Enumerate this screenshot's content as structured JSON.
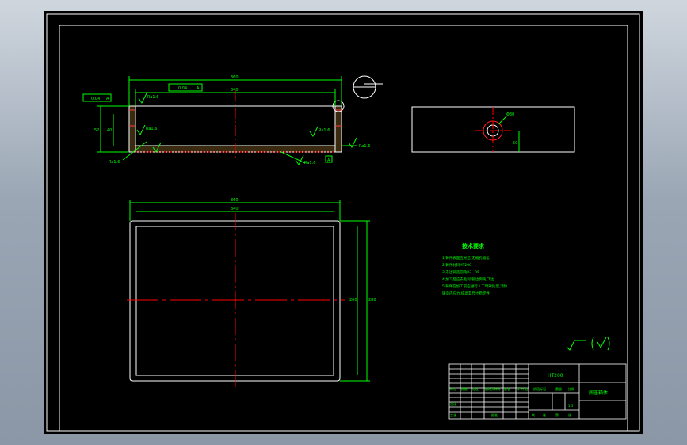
{
  "drawing": {
    "material": "HT200",
    "part_name": "底座箱体",
    "tech_title": "技术要求",
    "tech_notes": [
      "1.铸件表面应光洁,无缩孔缩松",
      "2.铸件材料HT200",
      "3.未注铸造圆角R3~R5",
      "4.加工后应去毛刺,锐边倒钝,飞边.",
      "5.铸件在加工前应进行人工时效处理,消除",
      "铸造内应力,提高其尺寸稳定性."
    ],
    "title_block": {
      "labels": [
        "标记",
        "处数",
        "分区",
        "更改文件号",
        "签名",
        "年.月.日"
      ],
      "stage_label": "阶段标记",
      "weight_label": "重量",
      "scale_label": "比例",
      "scale_value": "1:5",
      "sheet_labels": [
        "共",
        "张",
        "第",
        "张"
      ],
      "designer_label": "设计",
      "process_label": "工艺",
      "approve_label": "批准"
    },
    "dimensions": {
      "top_overall": "360",
      "top_inner": "340",
      "tol1_a": "0.04",
      "tol1_b": "A",
      "tol2_a": "0.04",
      "tol2_b": "A",
      "height": "52",
      "height2": "40",
      "rough_a": "Ra1.6",
      "rough_b": "Ra1.6",
      "rough_c": "Ra1.6",
      "rough_d": "Ra1.6",
      "rough_e": "Ra1.6",
      "rough_f": "Ra1.6",
      "datum": "A",
      "hole_dia": "Φ30",
      "hole_off": "50",
      "plan_w": "360",
      "plan_w2": "340",
      "plan_h": "280",
      "plan_h2": "260"
    }
  }
}
